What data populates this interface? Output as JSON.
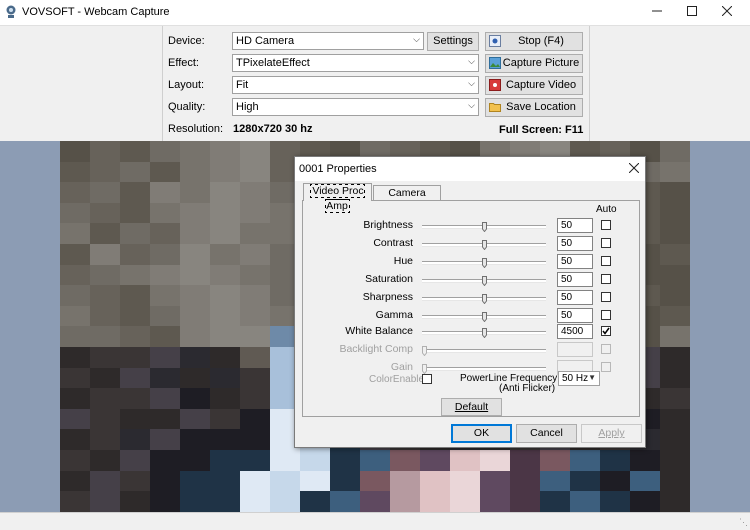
{
  "window": {
    "title": "VOVSOFT - Webcam Capture"
  },
  "controls": {
    "device_label": "Device:",
    "device_value": "HD Camera",
    "effect_label": "Effect:",
    "effect_value": "TPixelateEffect",
    "layout_label": "Layout:",
    "layout_value": "Fit",
    "quality_label": "Quality:",
    "quality_value": "High",
    "resolution_label": "Resolution:",
    "resolution_value": "1280x720 30 hz",
    "fullscreen_text": "Full Screen: F11",
    "settings_label": "Settings",
    "stop_label": "Stop (F4)",
    "capture_picture_label": "Capture Picture",
    "capture_video_label": "Capture Video",
    "save_location_label": "Save Location"
  },
  "dialog": {
    "title": "0001 Properties",
    "tabs": [
      "Video Proc Amp",
      "Camera Control"
    ],
    "auto_header": "Auto",
    "properties": [
      {
        "label": "Brightness",
        "value": "50",
        "level": 0.5,
        "auto": false,
        "enabled": true
      },
      {
        "label": "Contrast",
        "value": "50",
        "level": 0.5,
        "auto": false,
        "enabled": true
      },
      {
        "label": "Hue",
        "value": "50",
        "level": 0.5,
        "auto": false,
        "enabled": true
      },
      {
        "label": "Saturation",
        "value": "50",
        "level": 0.5,
        "auto": false,
        "enabled": true
      },
      {
        "label": "Sharpness",
        "value": "50",
        "level": 0.5,
        "auto": false,
        "enabled": true
      },
      {
        "label": "Gamma",
        "value": "50",
        "level": 0.5,
        "auto": false,
        "enabled": true
      },
      {
        "label": "White Balance",
        "value": "4500",
        "level": 0.5,
        "auto": true,
        "enabled": true
      },
      {
        "label": "Backlight Comp",
        "value": "",
        "level": 0,
        "auto": false,
        "enabled": false
      },
      {
        "label": "Gain",
        "value": "",
        "level": 0,
        "auto": false,
        "enabled": false
      }
    ],
    "color_enable_label": "ColorEnable",
    "powerline_label_1": "PowerLine Frequency",
    "powerline_label_2": "(Anti Flicker)",
    "powerline_value": "50 Hz",
    "default_label": "Default",
    "ok_label": "OK",
    "cancel_label": "Cancel",
    "apply_label": "Apply"
  },
  "colors": {
    "accent": "#0078d7",
    "video_bg": "#8c9cb4"
  },
  "preview": {
    "cols": 21,
    "palette": {
      "a": "#565148",
      "b": "#5e5950",
      "c": "#67625a",
      "d": "#6f6b64",
      "e": "#77736c",
      "f": "#807c76",
      "g": "#88857f",
      "h": "#605a53",
      "k": "#2e2a2a",
      "l": "#3a3535",
      "m": "#454048",
      "n": "#1e1d24",
      "p": "#6e8aa8",
      "q": "#a8c0da",
      "r": "#c6d8ea",
      "s": "#dfe9f4",
      "t": "#1f3346",
      "u": "#3d5f7e",
      "v": "#7a5860",
      "w": "#b69aa0",
      "x": "#e0c2c4",
      "y": "#ead6d8",
      "z": "#5f4960",
      "o": "#4b3646",
      "i": "#8aa2b8",
      "j": "#2b2a30"
    },
    "rows": [
      "acbdefgcbadcbaefgbcad",
      "bcdbefgchbdcbgefgbcde",
      "cdbfegfdcbefbdgfecdba",
      "dcbefgfecbdefbgfedcba",
      "ebdcfgeecbddfegfdccba",
      "bfcdgefdcbdefgfedcbab",
      "cdefgfedcbdefgfedcbaa",
      "dcbefgfdcbddfgrsedcba",
      "ecbdfgfedqrsfgedcbaab",
      "ddcbfggpqrsrgfedcbaae",
      "kllmjkhqspnmlkjjiilmk",
      "lkmjkjlqsiknmljkijlmk",
      "kllmnklqrinmlkjkjlmkl",
      "mlkkmlnsrnmlkjkjklmnk",
      "kljmnnnsrtmlkjklmkljk",
      "lkmnnttsrtuvzxyovutnk",
      "kmlnttsrstvwxyzoutnuk",
      "lmknttsrtuzwxyzotutnk"
    ]
  }
}
